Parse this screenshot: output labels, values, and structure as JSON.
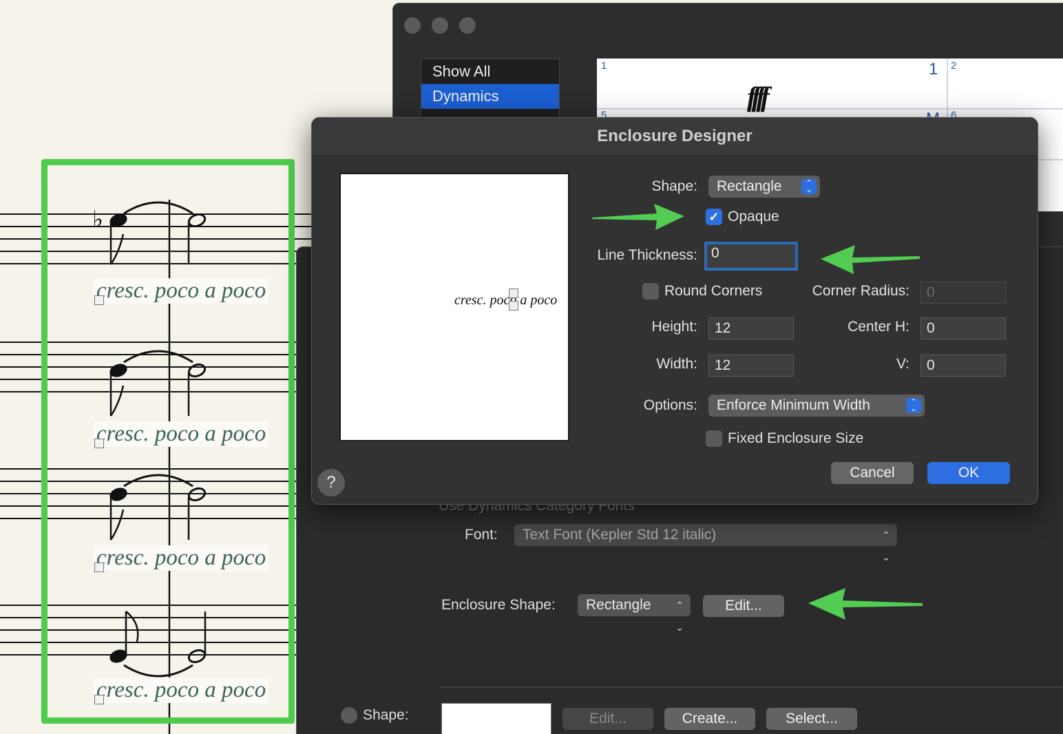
{
  "score": {
    "cresc_text": "cresc. poco a poco"
  },
  "palette_window": {
    "categories": [
      "Show All",
      "Dynamics"
    ],
    "selected_category": "Dynamics",
    "cells": [
      {
        "index": "1",
        "glyph": "ffff",
        "shortcut": "1"
      },
      {
        "index": "2"
      },
      {
        "index": "5",
        "shortcut": "M"
      },
      {
        "index": "6"
      }
    ]
  },
  "expression_dialog": {
    "use_category_fonts_label": "Use Dynamics Category Fonts",
    "font_label": "Font:",
    "font_value": "Text Font (Kepler Std 12  italic)",
    "enclosure_shape_label": "Enclosure Shape:",
    "enclosure_shape_value": "Rectangle",
    "edit_label": "Edit...",
    "shape_label": "Shape:",
    "shape_edit_label": "Edit...",
    "create_label": "Create...",
    "select_label": "Select..."
  },
  "enclosure_designer": {
    "title": "Enclosure Designer",
    "preview_text": "cresc. poco a poco",
    "shape_label": "Shape:",
    "shape_value": "Rectangle",
    "opaque_label": "Opaque",
    "opaque_checked": true,
    "line_thickness_label": "Line Thickness:",
    "line_thickness_value": "0",
    "round_corners_label": "Round Corners",
    "round_corners_checked": false,
    "corner_radius_label": "Corner Radius:",
    "corner_radius_value": "0",
    "height_label": "Height:",
    "height_value": "12",
    "center_h_label": "Center H:",
    "center_h_value": "0",
    "width_label": "Width:",
    "width_value": "12",
    "v_label": "V:",
    "v_value": "0",
    "options_label": "Options:",
    "options_value": "Enforce Minimum Width",
    "fixed_size_label": "Fixed Enclosure Size",
    "fixed_size_checked": false,
    "cancel_label": "Cancel",
    "ok_label": "OK",
    "help_label": "?"
  },
  "colors": {
    "highlight": "#4dcc4d",
    "accent": "#2d6fe0",
    "expression_text": "#3b6457"
  },
  "icons": [
    "flat-icon",
    "quarter-note-icon",
    "half-note-icon",
    "eighth-note-icon",
    "tie-icon",
    "popup-chevron-icon",
    "checkmark-icon",
    "help-icon",
    "annotation-arrow-icon"
  ]
}
